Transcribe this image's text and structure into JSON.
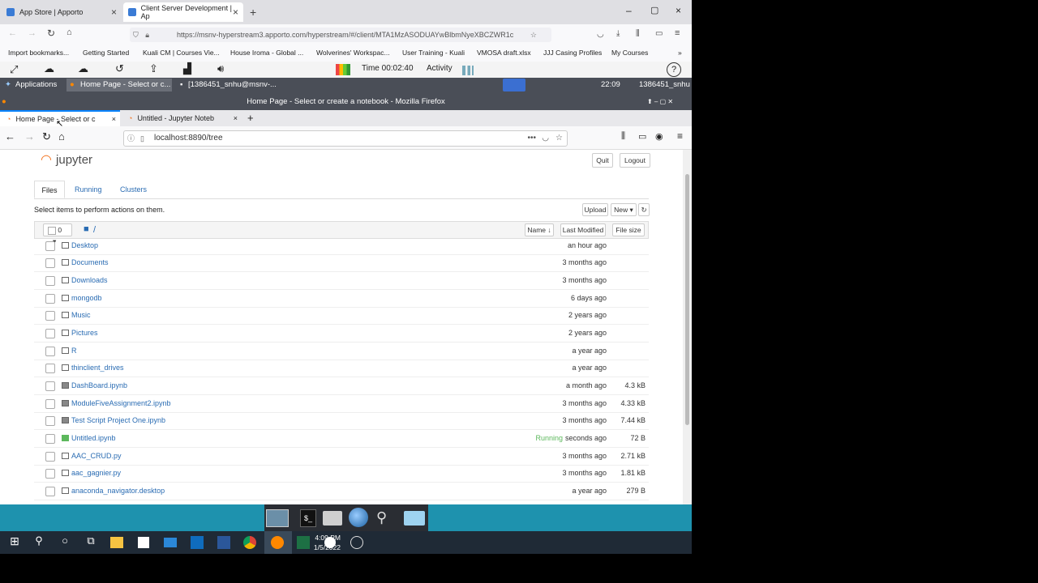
{
  "outer_tabs": [
    {
      "title": "App Store | Apporto",
      "active": false
    },
    {
      "title": "Client Server Development | Ap",
      "active": true
    }
  ],
  "outer_url": "https://msnv-hyperstream3.apporto.com/hyperstream/#/client/MTA1MzASODUAYwBlbmNyeXBCZWR1c",
  "bookmarks": [
    "Import bookmarks...",
    "Getting Started",
    "Kuali CM | Courses Vie...",
    "House Iroma - Global ...",
    "Wolverines' Workspac...",
    "User Training - Kuali",
    "VMOSA draft.xlsx",
    "JJJ Casing Profiles",
    "My Courses"
  ],
  "controls": {
    "time": "Time 00:02:40",
    "activity": "Activity"
  },
  "xfce": {
    "applications": "Applications",
    "task1": "Home Page - Select or c...",
    "task2": "[1386451_snhu@msnv-...",
    "clock": "22:09",
    "user": "1386451_snhu"
  },
  "ff": {
    "window_title": "Home Page - Select or create a notebook - Mozilla Firefox",
    "tab1": "Home Page - Select or c",
    "tab2": "Untitled - Jupyter Noteb",
    "url": "localhost:8890/tree"
  },
  "jupyter": {
    "logo": "jupyter",
    "quit": "Quit",
    "logout": "Logout",
    "tabs": [
      "Files",
      "Running",
      "Clusters"
    ],
    "hint": "Select items to perform actions on them.",
    "upload": "Upload",
    "new": "New ▾",
    "count": "0",
    "path": "/",
    "cols": {
      "name": "Name ↓",
      "modified": "Last Modified",
      "size": "File size"
    },
    "rows": [
      {
        "type": "folder",
        "name": "Desktop",
        "mod": "an hour ago",
        "size": ""
      },
      {
        "type": "folder",
        "name": "Documents",
        "mod": "3 months ago",
        "size": ""
      },
      {
        "type": "folder",
        "name": "Downloads",
        "mod": "3 months ago",
        "size": ""
      },
      {
        "type": "folder",
        "name": "mongodb",
        "mod": "6 days ago",
        "size": ""
      },
      {
        "type": "folder",
        "name": "Music",
        "mod": "2 years ago",
        "size": ""
      },
      {
        "type": "folder",
        "name": "Pictures",
        "mod": "2 years ago",
        "size": ""
      },
      {
        "type": "folder",
        "name": "R",
        "mod": "a year ago",
        "size": ""
      },
      {
        "type": "folder",
        "name": "thinclient_drives",
        "mod": "a year ago",
        "size": ""
      },
      {
        "type": "notebook",
        "name": "DashBoard.ipynb",
        "mod": "a month ago",
        "size": "4.3 kB"
      },
      {
        "type": "notebook",
        "name": "ModuleFiveAssignment2.ipynb",
        "mod": "3 months ago",
        "size": "4.33 kB"
      },
      {
        "type": "notebook",
        "name": "Test Script Project One.ipynb",
        "mod": "3 months ago",
        "size": "7.44 kB"
      },
      {
        "type": "notebook-running",
        "name": "Untitled.ipynb",
        "mod": "seconds ago",
        "size": "72 B",
        "status": "Running"
      },
      {
        "type": "file",
        "name": "AAC_CRUD.py",
        "mod": "3 months ago",
        "size": "2.71 kB"
      },
      {
        "type": "file",
        "name": "aac_gagnier.py",
        "mod": "3 months ago",
        "size": "1.81 kB"
      },
      {
        "type": "file",
        "name": "anaconda_navigator.desktop",
        "mod": "a year ago",
        "size": "279 B"
      }
    ]
  },
  "taskbar": {
    "time": "4:09 PM",
    "date": "1/5/2022"
  }
}
